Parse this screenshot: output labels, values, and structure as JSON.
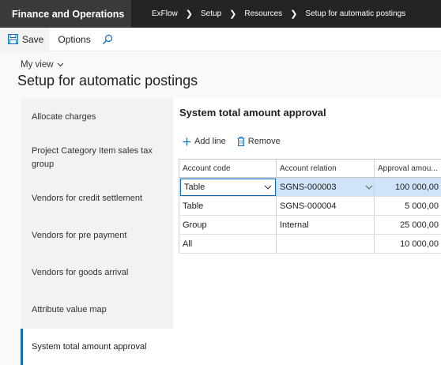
{
  "app": {
    "title": "Finance and Operations"
  },
  "breadcrumbs": [
    "ExFlow",
    "Setup",
    "Resources",
    "Setup for automatic postings"
  ],
  "actions": {
    "save_label": "Save",
    "options_label": "Options"
  },
  "header": {
    "view_label": "My view",
    "page_title": "Setup for automatic postings"
  },
  "left_nav": {
    "items": [
      {
        "label": "Allocate charges",
        "selected": false
      },
      {
        "label": "Project Category Item sales tax group",
        "selected": false
      },
      {
        "label": "Vendors for credit settlement",
        "selected": false
      },
      {
        "label": "Vendors for pre payment",
        "selected": false
      },
      {
        "label": "Vendors for goods arrival",
        "selected": false
      },
      {
        "label": "Attribute value map",
        "selected": false
      },
      {
        "label": "System total amount approval",
        "selected": true
      }
    ]
  },
  "section": {
    "title": "System total amount approval",
    "add_line_label": "Add line",
    "remove_label": "Remove"
  },
  "grid": {
    "columns": [
      "Account code",
      "Account relation",
      "Approval amou..."
    ],
    "rows": [
      {
        "account_code": "Table",
        "account_relation": "SGNS-000003",
        "approval_amount": "100 000,00"
      },
      {
        "account_code": "Table",
        "account_relation": "SGNS-000004",
        "approval_amount": "5 000,00"
      },
      {
        "account_code": "Group",
        "account_relation": "Internal",
        "approval_amount": "25 000,00"
      },
      {
        "account_code": "All",
        "account_relation": "",
        "approval_amount": "10 000,00"
      }
    ]
  },
  "colors": {
    "accent": "#0f6cbd",
    "topbar": "#252423",
    "selected_row": "#cfe4fa"
  }
}
